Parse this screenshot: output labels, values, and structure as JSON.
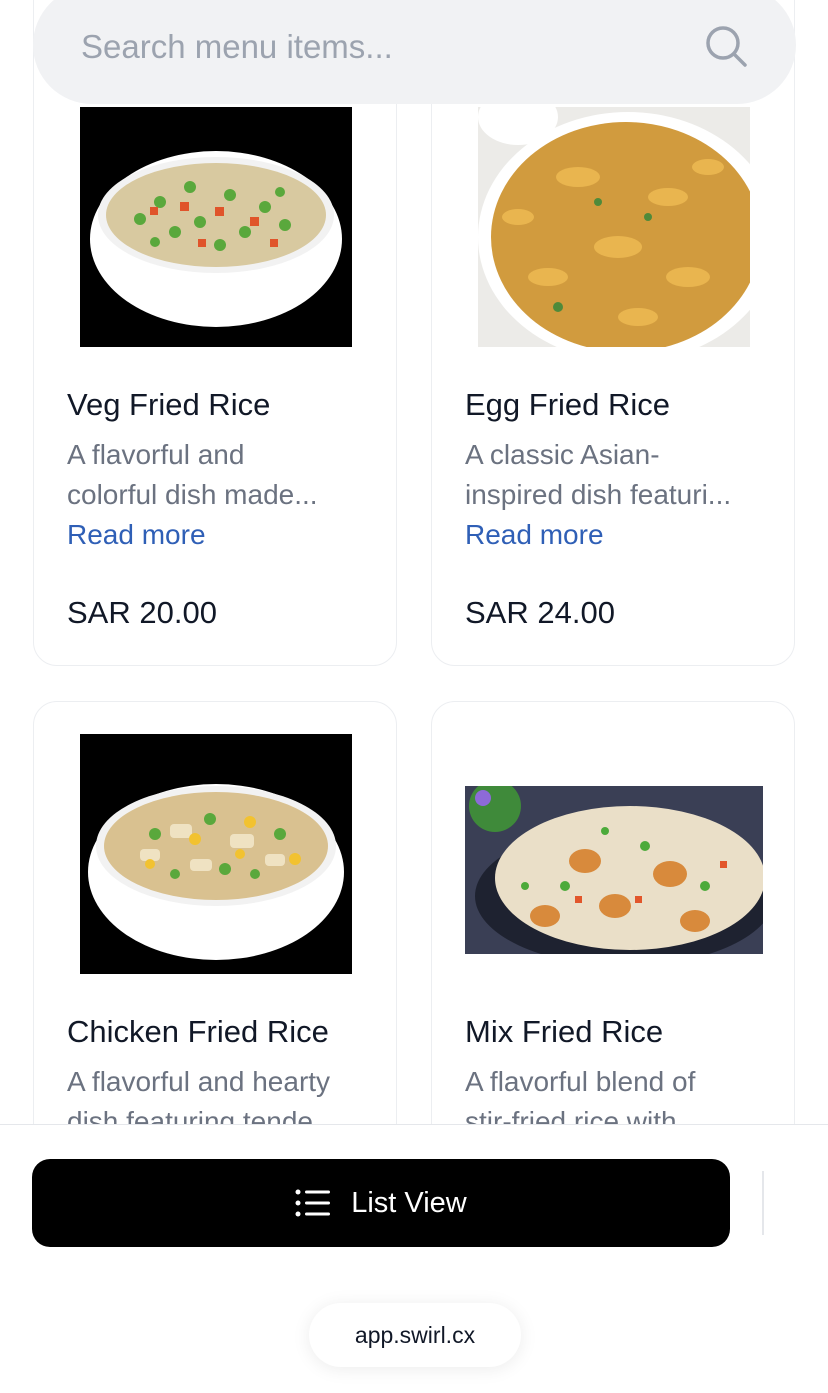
{
  "search": {
    "placeholder": "Search menu items..."
  },
  "items": [
    {
      "name": "Veg Fried Rice",
      "desc_line1": "A flavorful and",
      "desc_line2": "colorful dish made...",
      "read_more": "Read more",
      "price": "SAR 20.00"
    },
    {
      "name": "Egg Fried Rice",
      "desc_line1": "A classic Asian-",
      "desc_line2": "inspired dish featuri...",
      "read_more": "Read more",
      "price": "SAR 24.00"
    },
    {
      "name": "Chicken Fried Rice",
      "desc_line1": "A flavorful and hearty",
      "desc_line2": "dish featuring tende"
    },
    {
      "name": "Mix Fried Rice",
      "desc_line1": "A flavorful blend of",
      "desc_line2": "stir-fried rice with"
    }
  ],
  "footer": {
    "list_view_label": "List View",
    "url": "app.swirl.cx"
  },
  "colors": {
    "link": "#2f5fb6",
    "button": "#000000",
    "search_bg": "#f1f2f4"
  }
}
